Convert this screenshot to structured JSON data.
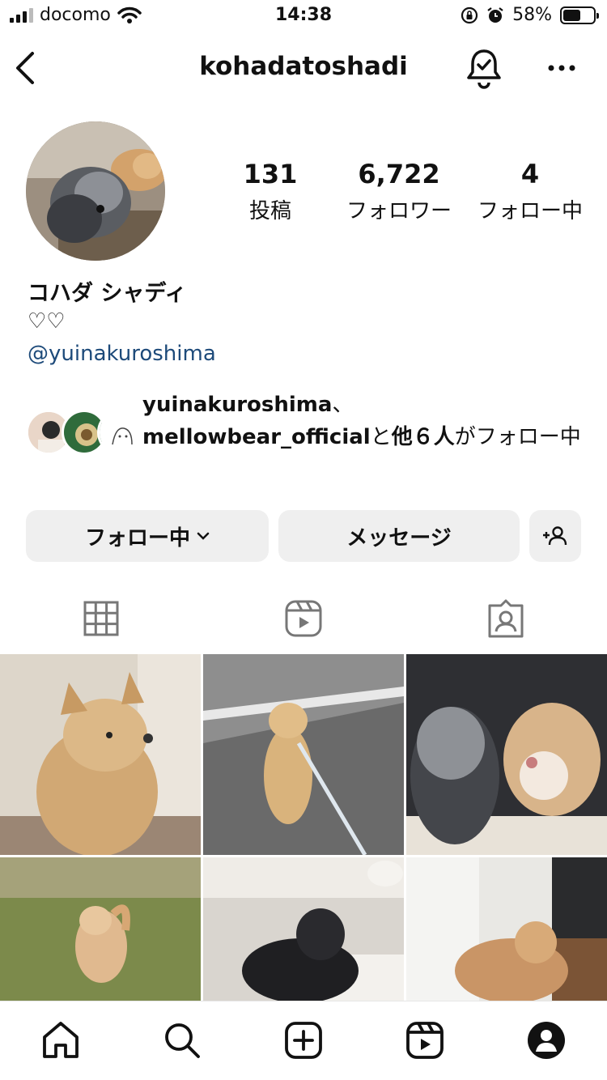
{
  "status_bar": {
    "carrier": "docomo",
    "time": "14:38",
    "battery": "58%",
    "battery_level": 0.58
  },
  "header": {
    "title": "kohadatoshadi",
    "back_icon": "chevron-left-icon",
    "notification_icon": "bell-check-icon",
    "more_icon": "more-horizontal-icon"
  },
  "profile": {
    "stats": [
      {
        "value": "131",
        "label": "投稿"
      },
      {
        "value": "6,722",
        "label": "フォロワー"
      },
      {
        "value": "4",
        "label": "フォロー中"
      }
    ],
    "name": "コハダ シャディ",
    "bio": "♡♡",
    "linked_handle": "@yuinakuroshima",
    "mutuals": {
      "user1": "yuinakuroshima",
      "sep1": "、",
      "user2": "mellowbear_official",
      "text_mid": "と",
      "others": "他６人",
      "text_end": "がフォロー中"
    }
  },
  "actions": {
    "follow_label": "フォロー中",
    "message_label": "メッセージ",
    "suggest_icon": "add-person-icon"
  },
  "tabs": [
    "grid-icon",
    "reels-icon",
    "tagged-icon"
  ],
  "bottom_nav": [
    "home-icon",
    "search-icon",
    "create-icon",
    "reels-icon",
    "profile-icon"
  ]
}
